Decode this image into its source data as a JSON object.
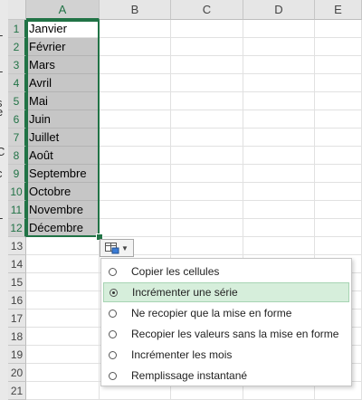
{
  "columns": [
    "A",
    "B",
    "C",
    "D",
    "E"
  ],
  "rows": [
    "1",
    "2",
    "3",
    "4",
    "5",
    "6",
    "7",
    "8",
    "9",
    "10",
    "11",
    "12",
    "13",
    "14",
    "15",
    "16",
    "17",
    "18",
    "19",
    "20",
    "21"
  ],
  "cells_a": [
    "Janvier",
    "Février",
    "Mars",
    "Avril",
    "Mai",
    "Juin",
    "Juillet",
    "Août",
    "Septembre",
    "Octobre",
    "Novembre",
    "Décembre"
  ],
  "selected_rows": 12,
  "left_strip_chars": [
    "L",
    "L",
    "s",
    "e",
    "C",
    "c",
    "L"
  ],
  "autofill_menu": {
    "selected_index": 1,
    "options": [
      "Copier les cellules",
      "Incrémenter une série",
      "Ne recopier que la mise en forme",
      "Recopier les valeurs sans la mise en forme",
      "Incrémenter les mois",
      "Remplissage instantané"
    ]
  },
  "colors": {
    "accent": "#217346",
    "selection": "#c6c6c6",
    "menu_highlight": "#d6eedb"
  },
  "icons": {
    "autofill": "autofill-options-icon",
    "chevron": "chevron-down-icon",
    "radio": "radio-icon"
  }
}
